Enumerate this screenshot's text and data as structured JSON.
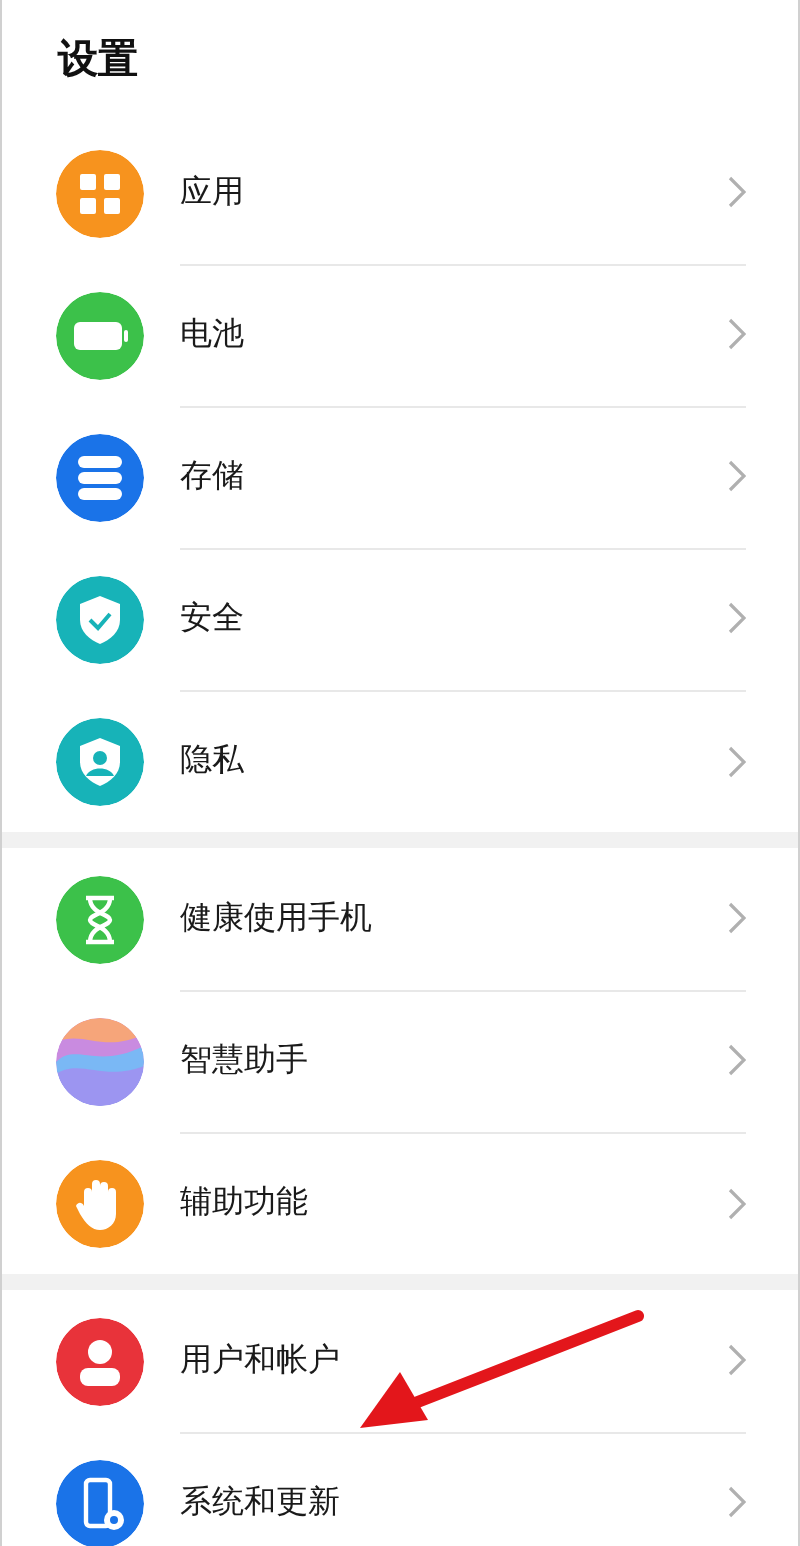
{
  "title": "设置",
  "sections": [
    {
      "items": [
        {
          "label": "应用",
          "kind": "apps",
          "color": "#f7931e"
        },
        {
          "label": "电池",
          "kind": "battery",
          "color": "#3cc14a"
        },
        {
          "label": "存储",
          "kind": "storage",
          "color": "#1a73e8"
        },
        {
          "label": "安全",
          "kind": "security",
          "color": "#17b3b8"
        },
        {
          "label": "隐私",
          "kind": "privacy",
          "color": "#17b3b8"
        }
      ]
    },
    {
      "items": [
        {
          "label": "健康使用手机",
          "kind": "hourglass",
          "color": "#3cc14a"
        },
        {
          "label": "智慧助手",
          "kind": "assistant",
          "color": "#c98be0"
        },
        {
          "label": "辅助功能",
          "kind": "hand",
          "color": "#f7931e"
        }
      ]
    },
    {
      "items": [
        {
          "label": "用户和帐户",
          "kind": "user",
          "color": "#e8333a"
        },
        {
          "label": "系统和更新",
          "kind": "system",
          "color": "#1a73e8"
        }
      ]
    }
  ]
}
